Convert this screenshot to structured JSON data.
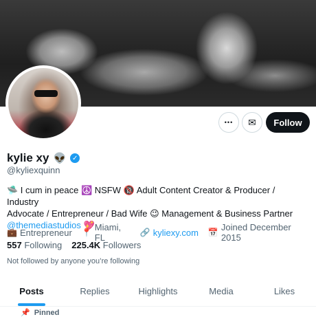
{
  "profile": {
    "display_name": "kylie xy",
    "name_emoji": "👽",
    "handle": "@kyliexquinn",
    "bio_line1": "🛸 I cum in peace ☮️ NSFW 🔞 Adult Content Creator & Producer / Industry",
    "bio_line2": "Advocate / Entrepreneur / Bad Wife 😉 Management & Business Partner",
    "bio_mention": "@themediastudios",
    "bio_mention_emoji": "💖",
    "category": "Entrepreneur",
    "location": "Miami, FL",
    "website": "kyliexy.com",
    "joined": "Joined December 2015",
    "following_count": "557",
    "following_label": "Following",
    "followers_count": "225.4K",
    "followers_label": "Followers",
    "mutuals_text": "Not followed by anyone you’re following"
  },
  "actions": {
    "more_glyph": "•••",
    "message_glyph": "✉",
    "follow_label": "Follow"
  },
  "tabs": [
    {
      "label": "Posts"
    },
    {
      "label": "Replies"
    },
    {
      "label": "Highlights"
    },
    {
      "label": "Media"
    },
    {
      "label": "Likes"
    }
  ],
  "pinned_label": "Pinned",
  "colors": {
    "accent": "#1d9bf0",
    "follow_button": "#0f1419"
  }
}
